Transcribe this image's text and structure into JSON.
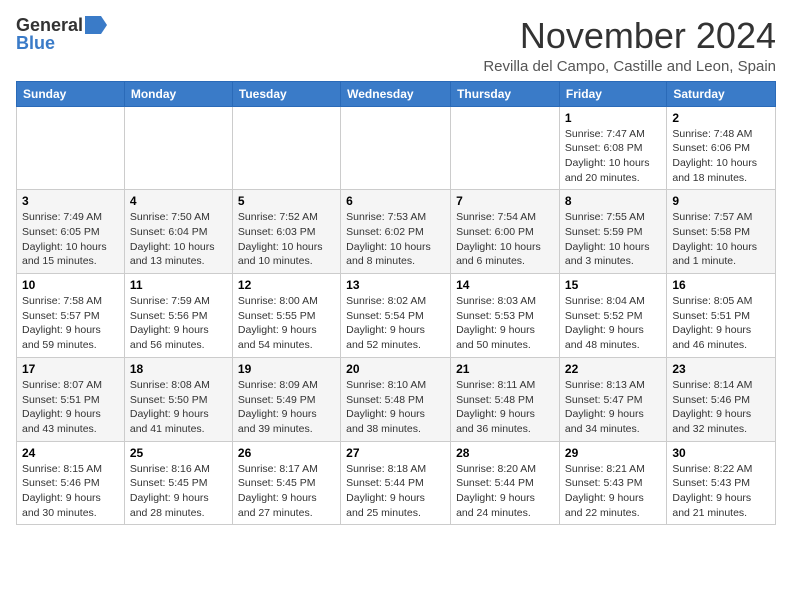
{
  "logo": {
    "general": "General",
    "blue": "Blue"
  },
  "title": {
    "month": "November 2024",
    "location": "Revilla del Campo, Castille and Leon, Spain"
  },
  "weekdays": [
    "Sunday",
    "Monday",
    "Tuesday",
    "Wednesday",
    "Thursday",
    "Friday",
    "Saturday"
  ],
  "weeks": [
    [
      {
        "day": "",
        "content": ""
      },
      {
        "day": "",
        "content": ""
      },
      {
        "day": "",
        "content": ""
      },
      {
        "day": "",
        "content": ""
      },
      {
        "day": "",
        "content": ""
      },
      {
        "day": "1",
        "content": "Sunrise: 7:47 AM\nSunset: 6:08 PM\nDaylight: 10 hours and 20 minutes."
      },
      {
        "day": "2",
        "content": "Sunrise: 7:48 AM\nSunset: 6:06 PM\nDaylight: 10 hours and 18 minutes."
      }
    ],
    [
      {
        "day": "3",
        "content": "Sunrise: 7:49 AM\nSunset: 6:05 PM\nDaylight: 10 hours and 15 minutes."
      },
      {
        "day": "4",
        "content": "Sunrise: 7:50 AM\nSunset: 6:04 PM\nDaylight: 10 hours and 13 minutes."
      },
      {
        "day": "5",
        "content": "Sunrise: 7:52 AM\nSunset: 6:03 PM\nDaylight: 10 hours and 10 minutes."
      },
      {
        "day": "6",
        "content": "Sunrise: 7:53 AM\nSunset: 6:02 PM\nDaylight: 10 hours and 8 minutes."
      },
      {
        "day": "7",
        "content": "Sunrise: 7:54 AM\nSunset: 6:00 PM\nDaylight: 10 hours and 6 minutes."
      },
      {
        "day": "8",
        "content": "Sunrise: 7:55 AM\nSunset: 5:59 PM\nDaylight: 10 hours and 3 minutes."
      },
      {
        "day": "9",
        "content": "Sunrise: 7:57 AM\nSunset: 5:58 PM\nDaylight: 10 hours and 1 minute."
      }
    ],
    [
      {
        "day": "10",
        "content": "Sunrise: 7:58 AM\nSunset: 5:57 PM\nDaylight: 9 hours and 59 minutes."
      },
      {
        "day": "11",
        "content": "Sunrise: 7:59 AM\nSunset: 5:56 PM\nDaylight: 9 hours and 56 minutes."
      },
      {
        "day": "12",
        "content": "Sunrise: 8:00 AM\nSunset: 5:55 PM\nDaylight: 9 hours and 54 minutes."
      },
      {
        "day": "13",
        "content": "Sunrise: 8:02 AM\nSunset: 5:54 PM\nDaylight: 9 hours and 52 minutes."
      },
      {
        "day": "14",
        "content": "Sunrise: 8:03 AM\nSunset: 5:53 PM\nDaylight: 9 hours and 50 minutes."
      },
      {
        "day": "15",
        "content": "Sunrise: 8:04 AM\nSunset: 5:52 PM\nDaylight: 9 hours and 48 minutes."
      },
      {
        "day": "16",
        "content": "Sunrise: 8:05 AM\nSunset: 5:51 PM\nDaylight: 9 hours and 46 minutes."
      }
    ],
    [
      {
        "day": "17",
        "content": "Sunrise: 8:07 AM\nSunset: 5:51 PM\nDaylight: 9 hours and 43 minutes."
      },
      {
        "day": "18",
        "content": "Sunrise: 8:08 AM\nSunset: 5:50 PM\nDaylight: 9 hours and 41 minutes."
      },
      {
        "day": "19",
        "content": "Sunrise: 8:09 AM\nSunset: 5:49 PM\nDaylight: 9 hours and 39 minutes."
      },
      {
        "day": "20",
        "content": "Sunrise: 8:10 AM\nSunset: 5:48 PM\nDaylight: 9 hours and 38 minutes."
      },
      {
        "day": "21",
        "content": "Sunrise: 8:11 AM\nSunset: 5:48 PM\nDaylight: 9 hours and 36 minutes."
      },
      {
        "day": "22",
        "content": "Sunrise: 8:13 AM\nSunset: 5:47 PM\nDaylight: 9 hours and 34 minutes."
      },
      {
        "day": "23",
        "content": "Sunrise: 8:14 AM\nSunset: 5:46 PM\nDaylight: 9 hours and 32 minutes."
      }
    ],
    [
      {
        "day": "24",
        "content": "Sunrise: 8:15 AM\nSunset: 5:46 PM\nDaylight: 9 hours and 30 minutes."
      },
      {
        "day": "25",
        "content": "Sunrise: 8:16 AM\nSunset: 5:45 PM\nDaylight: 9 hours and 28 minutes."
      },
      {
        "day": "26",
        "content": "Sunrise: 8:17 AM\nSunset: 5:45 PM\nDaylight: 9 hours and 27 minutes."
      },
      {
        "day": "27",
        "content": "Sunrise: 8:18 AM\nSunset: 5:44 PM\nDaylight: 9 hours and 25 minutes."
      },
      {
        "day": "28",
        "content": "Sunrise: 8:20 AM\nSunset: 5:44 PM\nDaylight: 9 hours and 24 minutes."
      },
      {
        "day": "29",
        "content": "Sunrise: 8:21 AM\nSunset: 5:43 PM\nDaylight: 9 hours and 22 minutes."
      },
      {
        "day": "30",
        "content": "Sunrise: 8:22 AM\nSunset: 5:43 PM\nDaylight: 9 hours and 21 minutes."
      }
    ]
  ]
}
